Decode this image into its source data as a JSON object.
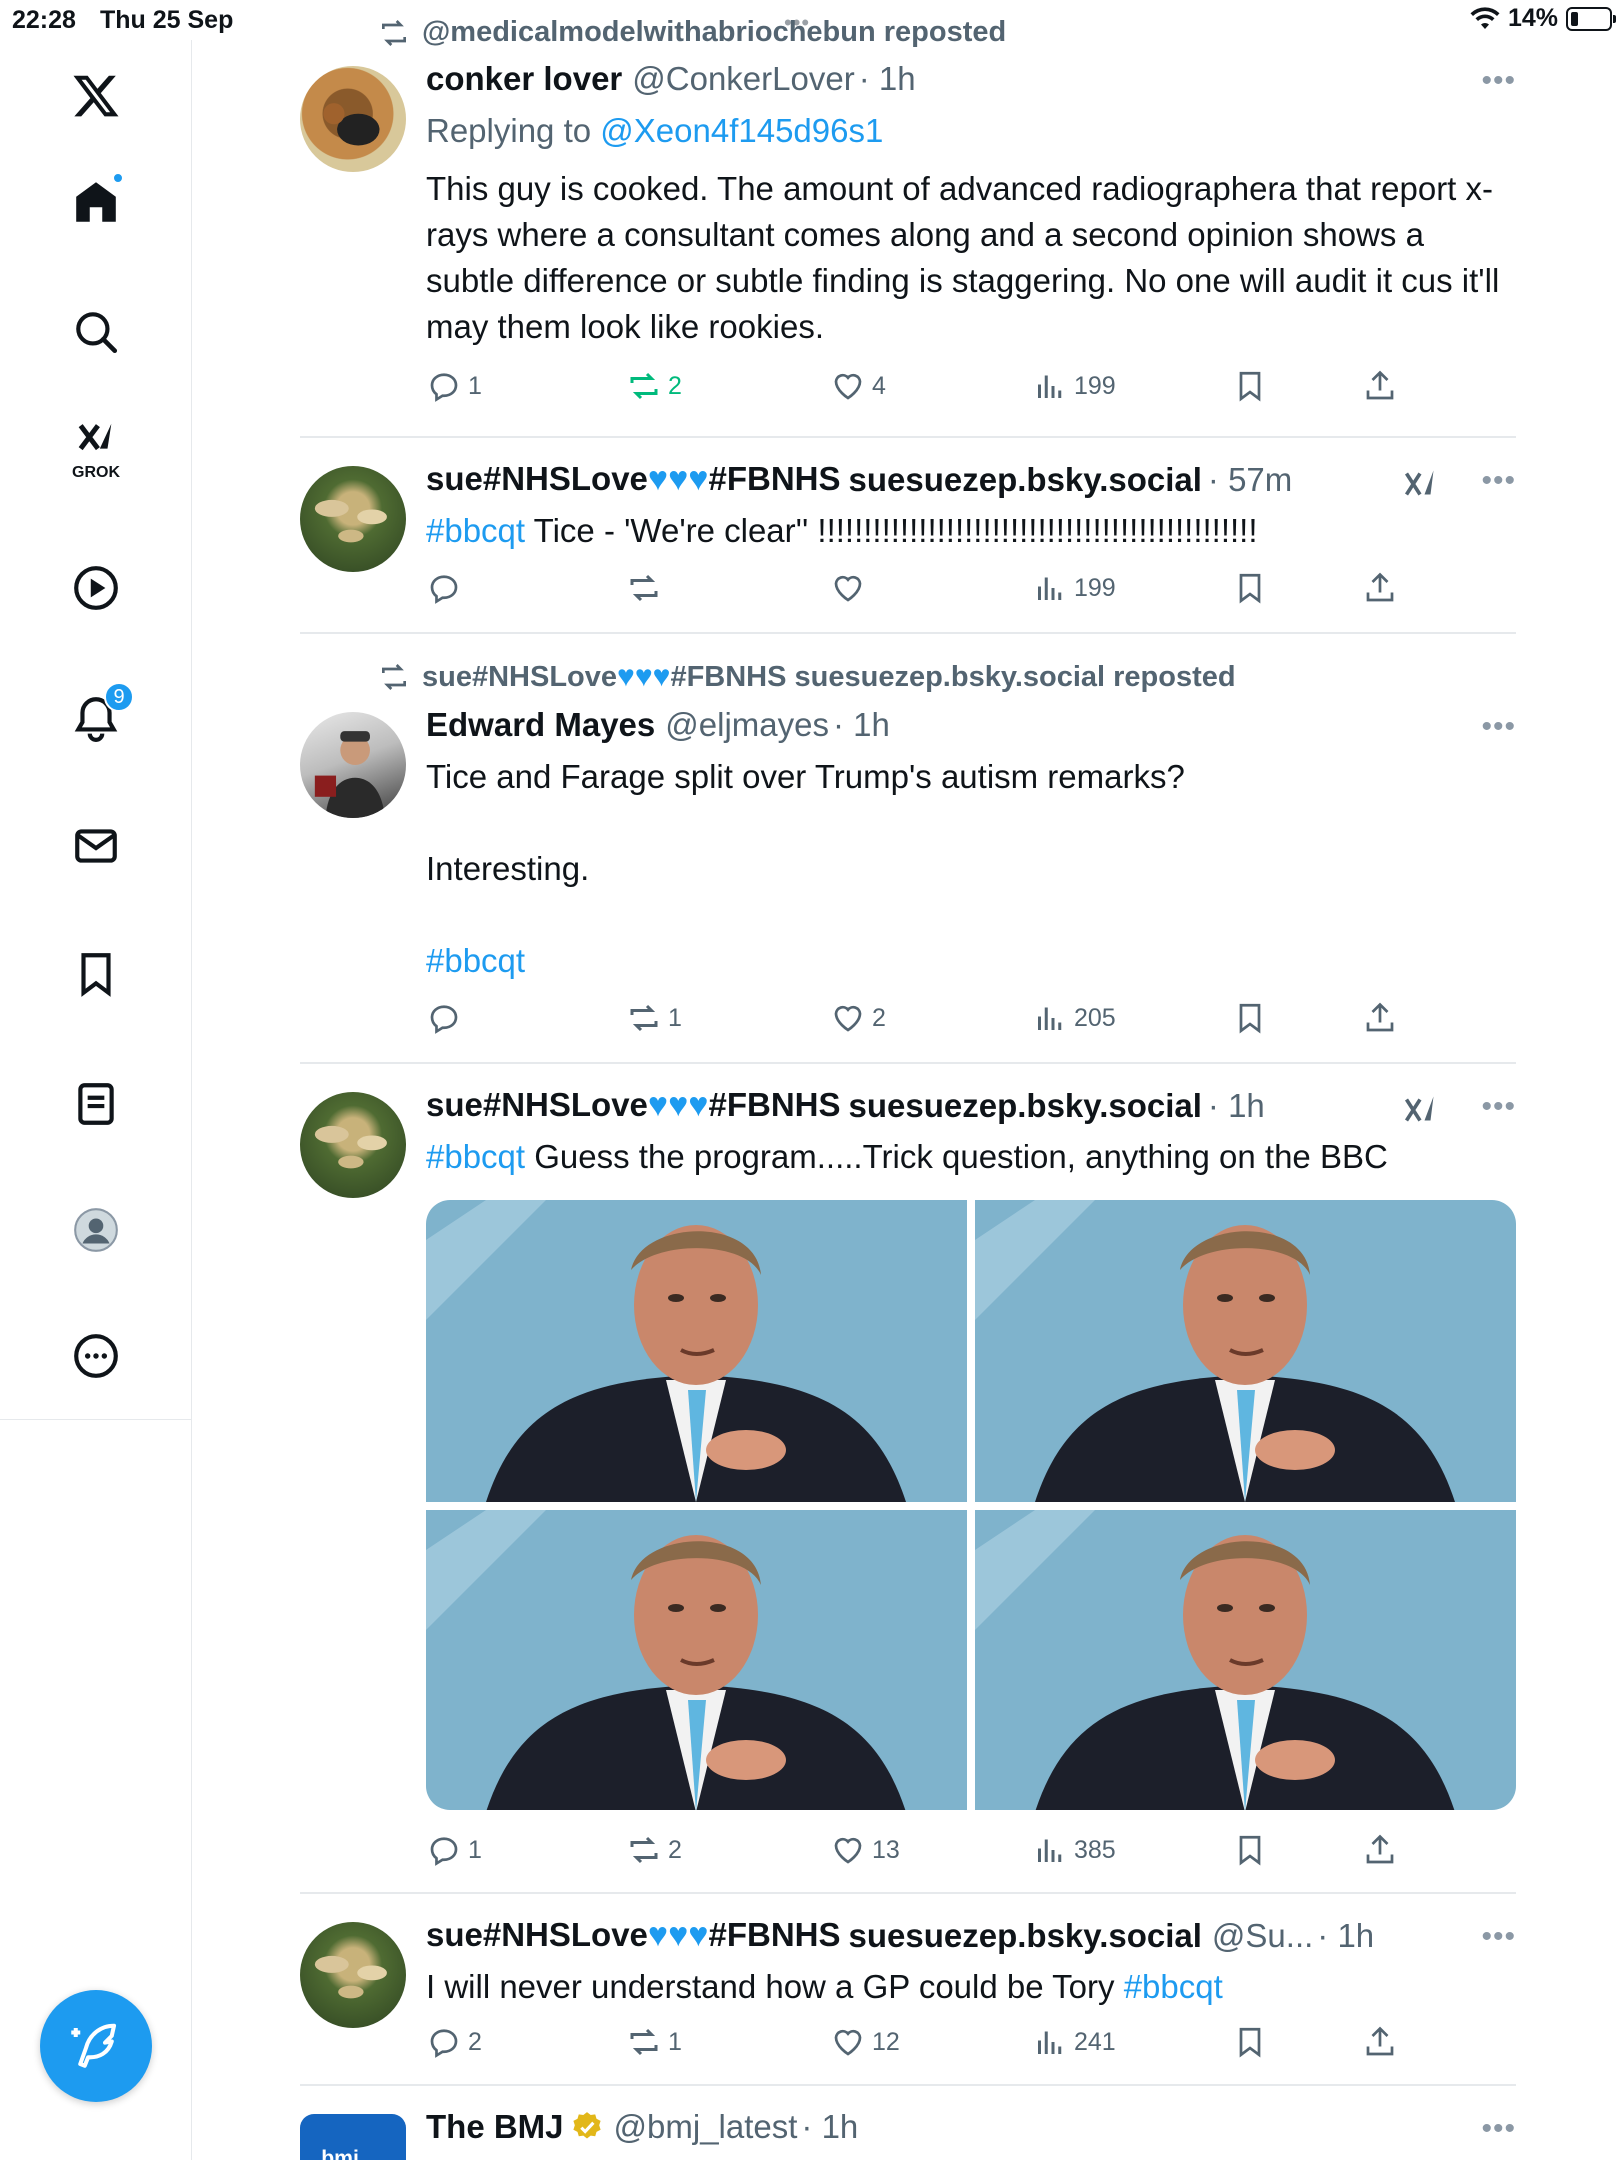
{
  "status_bar": {
    "time": "22:28",
    "date": "Thu 25 Sep",
    "battery": "14%"
  },
  "sidebar": {
    "icons": [
      "x-logo-icon",
      "home-icon",
      "search-icon",
      "grok-icon",
      "video-icon",
      "notifications-icon",
      "messages-icon",
      "bookmarks-icon",
      "lists-icon",
      "profile-icon",
      "more-icon"
    ],
    "grok_label": "GROK",
    "notifications_badge": "9"
  },
  "colors": {
    "accent": "#1d9bf0",
    "repost_green": "#00ba7c",
    "muted": "#536471"
  },
  "tweets": [
    {
      "repost_by": "@medicalmodelwithabriochebun reposted",
      "name": "conker lover",
      "handle": "@ConkerLover",
      "time": "· 1h",
      "replying_prefix": "Replying to ",
      "replying_handle": "@Xeon4f145d96s1",
      "text": "This guy is cooked. The amount of advanced radiographera that report x-rays where a consultant comes along and a second opinion shows a subtle difference or subtle finding is staggering. No one will audit it cus it'll may them look like rookies.",
      "replies": "1",
      "reposts": "2",
      "likes": "4",
      "views": "199"
    },
    {
      "name_prefix": "sue#NHSLove",
      "name_suffix": "#FBNHS",
      "handle": "suesuezep.bsky.social",
      "time": "· 57m",
      "hashtag": "#bbcqt",
      "text": " Tice - 'We're clear'' !!!!!!!!!!!!!!!!!!!!!!!!!!!!!!!!!!!!!!!!!!!!!!!!",
      "replies": "",
      "reposts": "",
      "likes": "",
      "views": "199"
    },
    {
      "repost_by_prefix": "sue#NHSLove",
      "repost_by_suffix": "#FBNHS suesuezep.bsky.social reposted",
      "name": "Edward Mayes",
      "handle": "@eljmayes",
      "time": "· 1h",
      "line1": "Tice and Farage split over Trump's autism remarks?",
      "line2": "Interesting.",
      "hashtag": "#bbcqt",
      "replies": "",
      "reposts": "1",
      "likes": "2",
      "views": "205"
    },
    {
      "name_prefix": "sue#NHSLove",
      "name_suffix": "#FBNHS",
      "handle": "suesuezep.bsky.social",
      "time": "· 1h",
      "hashtag": "#bbcqt",
      "text": "  Guess the program.....Trick question, anything on the BBC",
      "replies": "1",
      "reposts": "2",
      "likes": "13",
      "views": "385"
    },
    {
      "name_prefix": "sue#NHSLove",
      "name_suffix": "#FBNHS",
      "handle": "suesuezep.bsky.social",
      "handle2": "@Su...",
      "time": "· 1h",
      "text": "I will never understand how a GP could be Tory ",
      "hashtag": "#bbcqt",
      "replies": "2",
      "reposts": "1",
      "likes": "12",
      "views": "241"
    },
    {
      "name": "The BMJ",
      "handle": "@bmj_latest",
      "time": "· 1h"
    }
  ]
}
